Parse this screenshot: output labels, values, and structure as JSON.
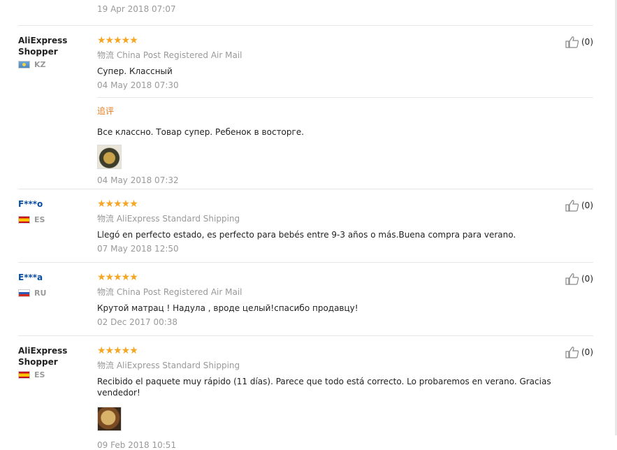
{
  "top_review": {
    "date": "19 Apr 2018 07:07"
  },
  "shipping_label": "物流",
  "reviews": [
    {
      "user": "AliExpress Shopper",
      "country": "KZ",
      "shipping": "China Post Registered Air Mail",
      "text": "Супер. Классный",
      "date": "04 May 2018 07:30",
      "likes": "(0)",
      "followup": {
        "label": "追评",
        "text": "Все классно. Товар супер. Ребенок в восторге.",
        "date": "04 May 2018 07:32"
      }
    },
    {
      "user": "F***o",
      "country": "ES",
      "shipping": "AliExpress Standard Shipping",
      "text": "Llegó en perfecto estado, es perfecto para bebés entre 9-3 años o más.Buena compra para verano.",
      "date": "07 May 2018 12:50",
      "likes": "(0)"
    },
    {
      "user": "E***a",
      "country": "RU",
      "shipping": "China Post Registered Air Mail",
      "text": "Крутой матрац ! Надула , вроде целый!спасибо продавцу!",
      "date": "02 Dec 2017 00:38",
      "likes": "(0)"
    },
    {
      "user": "AliExpress Shopper",
      "country": "ES",
      "shipping": "AliExpress Standard Shipping",
      "text": "Recibido el paquete muy rápido (11 días). Parece que todo está correcto. Lo probaremos en verano. Gracias vendedor!",
      "date": "09 Feb 2018 10:51",
      "likes": "(0)"
    }
  ],
  "rating_stars": "★★★★★",
  "colors": {
    "stars": "#f5a623",
    "followup": "#e67e22",
    "masked_user": "#0a4da2"
  }
}
